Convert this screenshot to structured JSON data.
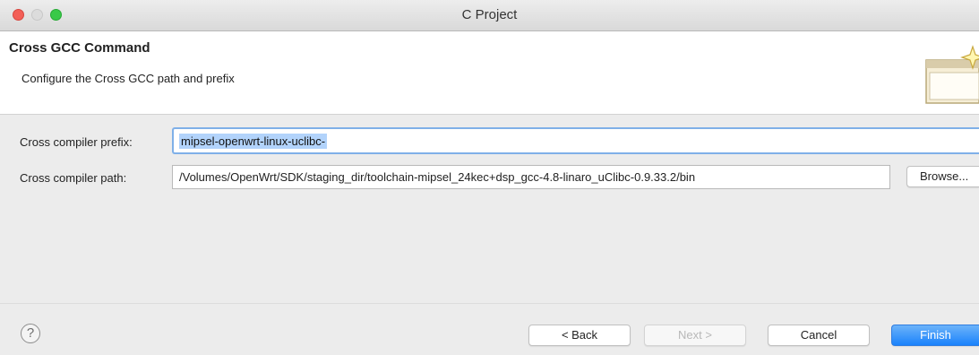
{
  "window": {
    "title": "C Project"
  },
  "header": {
    "title": "Cross GCC Command",
    "description": "Configure the Cross GCC path and prefix"
  },
  "form": {
    "prefix_label": "Cross compiler prefix:",
    "prefix_value": "mipsel-openwrt-linux-uclibc-",
    "path_label": "Cross compiler path:",
    "path_value": "/Volumes/OpenWrt/SDK/staging_dir/toolchain-mipsel_24kec+dsp_gcc-4.8-linaro_uClibc-0.9.33.2/bin",
    "browse_label": "Browse..."
  },
  "footer": {
    "help_symbol": "?",
    "back_label": "< Back",
    "next_label": "Next >",
    "cancel_label": "Cancel",
    "finish_label": "Finish"
  },
  "colors": {
    "accent": "#1a82fb",
    "close": "#f35f57",
    "maximize": "#39c948",
    "selection": "#b2d3fb"
  },
  "icons": {
    "wizard": "wizard-banner-icon",
    "help": "help-icon"
  }
}
